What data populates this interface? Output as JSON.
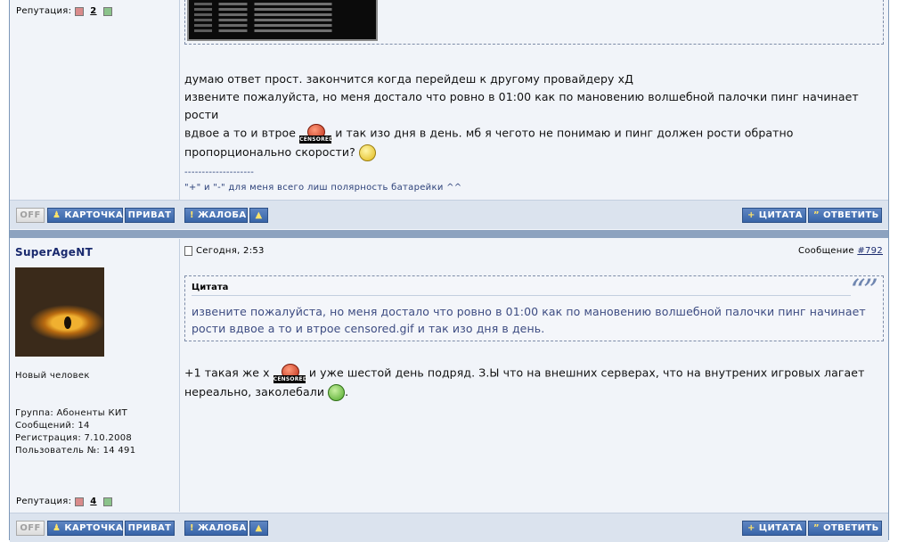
{
  "post1": {
    "reputation_label": "Репутация:",
    "reputation_value": "2",
    "body_lines": [
      "думаю ответ прост. закончится когда перейдеш к другому провайдеру xД",
      "извените пожалуйста, но меня достало что ровно в 01:00 как по мановению волшебной палочки пинг начинает рости",
      "вдвое а то и втрое",
      "и так изо дня в день. мб я чегото не понимаю и пинг должен рости обратно",
      "пропорционально скорости?"
    ],
    "signature_sep": "--------------------",
    "signature": "\"+\" и \"-\" для меня всего лиш полярность батарейки ^^"
  },
  "buttons": {
    "off": "OFF",
    "profile": "КАРТОЧКА",
    "private": "ПРИВАТ",
    "report": "ЖАЛОБА",
    "quote": "ЦИТАТА",
    "reply": "ОТВЕТИТЬ"
  },
  "post2": {
    "author": "SuperAgeNT",
    "date": "Сегодня, 2:53",
    "message_label": "Сообщение",
    "message_number": "#792",
    "rank": "Новый человек",
    "group": "Группа: Абоненты КИТ",
    "messages": "Сообщений: 14",
    "registration": "Регистрация: 7.10.2008",
    "user_no": "Пользователь №: 14 491",
    "reputation_label": "Репутация:",
    "reputation_value": "4",
    "quote_title": "Цитата",
    "quote_marks": "“”",
    "quote_line1": "извените пожалуйста, но меня достало что ровно в 01:00 как по мановению волшебной палочки пинг начинает",
    "quote_line2": "рости вдвое а то и втрое censored.gif и так изо дня в день.",
    "body_line1_a": "+1 такая же х",
    "body_line1_b": "и уже шестой день подряд. З.Ы что на внешних серверах, что на внутрених игровых лагает",
    "body_line2": "нереально, заколебали",
    "body_line2_end": "."
  },
  "censored_label": "CENSORED",
  "colors": {
    "button_blue": "#3865a8",
    "author_color": "#1a2a6e",
    "bar_color": "#8ca2bf"
  }
}
